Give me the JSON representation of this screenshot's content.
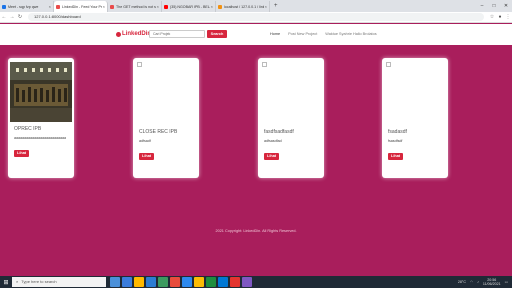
{
  "browser": {
    "tabs": [
      {
        "title": "Meet - sqp fzp qwe",
        "favicon": "#1a73e8",
        "active": false
      },
      {
        "title": "LinkedDin - Feed Your Project Da",
        "favicon": "#e94b4b",
        "active": true
      },
      {
        "title": "The GET method is not supp",
        "favicon": "#e94b4b",
        "active": false
      },
      {
        "title": "(35) NGOBAR IPB - BELAJAR LAR",
        "favicon": "#ff0000",
        "active": false
      },
      {
        "title": "localhost / 127.0.0.1 / linked / p",
        "favicon": "#f29111",
        "active": false
      }
    ],
    "new_tab": "+",
    "url": "127.0.0.1:8000/dashboard",
    "window_controls": [
      "–",
      "□",
      "✕"
    ]
  },
  "site": {
    "brand": "LinkedDin",
    "search_placeholder": "Cari Projek",
    "search_button": "Search",
    "nav_links": [
      "Home",
      "Post New Project",
      "Waktue Syahrie Hallo Brolatos"
    ]
  },
  "cards": [
    {
      "has_image": true,
      "title": "OPREC IPB",
      "desc": "aaaaaaaaaaaaaaaaaaaaaaaaaa",
      "button": "Lihat"
    },
    {
      "has_image": false,
      "title": "CLOSE REC IPB",
      "desc": "adfsadf",
      "button": "Lihat"
    },
    {
      "has_image": false,
      "title": "fasdfsadfasdf",
      "desc": "adfsasdfad",
      "button": "Lihat"
    },
    {
      "has_image": false,
      "title": "fsadasdf",
      "desc": "fsasdfsdf",
      "button": "Lihat"
    }
  ],
  "footer": "2021 Copyright: LinkedDin. All Rights Reserved.",
  "taskbar": {
    "search_placeholder": "Type here to search",
    "apps": [
      "#4a90d9",
      "#3b7ddd",
      "#ffb900",
      "#2b7cd3",
      "#3c9a5f",
      "#e74c3c",
      "#2d89ef",
      "#fbbc05",
      "#1e8e3e",
      "#0078d4",
      "#e3342f",
      "#7e57c2"
    ],
    "temperature": "28°C",
    "time": "20:56",
    "date": "11/06/2021"
  },
  "colors": {
    "background": "#a91e5c",
    "accent": "#d7263d"
  }
}
